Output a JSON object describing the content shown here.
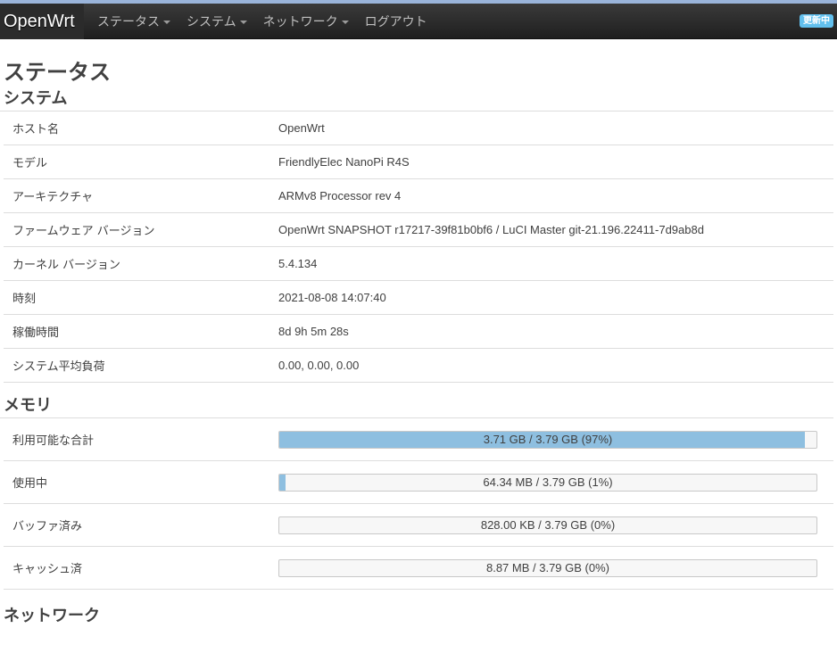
{
  "navbar": {
    "brand": "OpenWrt",
    "menu": [
      {
        "label": "ステータス",
        "dropdown": true
      },
      {
        "label": "システム",
        "dropdown": true
      },
      {
        "label": "ネットワーク",
        "dropdown": true
      },
      {
        "label": "ログアウト",
        "dropdown": false
      }
    ],
    "badge": "更新中"
  },
  "page": {
    "title": "ステータス"
  },
  "system": {
    "title": "システム",
    "rows": [
      {
        "label": "ホスト名",
        "value": "OpenWrt"
      },
      {
        "label": "モデル",
        "value": "FriendlyElec NanoPi R4S"
      },
      {
        "label": "アーキテクチャ",
        "value": "ARMv8 Processor rev 4"
      },
      {
        "label": "ファームウェア バージョン",
        "value": "OpenWrt SNAPSHOT r17217-39f81b0bf6 / LuCI Master git-21.196.22411-7d9ab8d"
      },
      {
        "label": "カーネル バージョン",
        "value": "5.4.134"
      },
      {
        "label": "時刻",
        "value": "2021-08-08 14:07:40"
      },
      {
        "label": "稼働時間",
        "value": "8d 9h 5m 28s"
      },
      {
        "label": "システム平均負荷",
        "value": "0.00, 0.00, 0.00"
      }
    ]
  },
  "memory": {
    "title": "メモリ",
    "rows": [
      {
        "label": "利用可能な合計",
        "text": "3.71 GB / 3.79 GB (97%)",
        "percent": 97.9
      },
      {
        "label": "使用中",
        "text": "64.34 MB / 3.79 GB (1%)",
        "percent": 1.1
      },
      {
        "label": "バッファ済み",
        "text": "828.00 KB / 3.79 GB (0%)",
        "percent": 0
      },
      {
        "label": "キャッシュ済",
        "text": "8.87 MB / 3.79 GB (0%)",
        "percent": 0
      }
    ]
  },
  "network": {
    "title": "ネットワーク"
  },
  "colors": {
    "progress_fill": "#8ebfe0",
    "navbar_bg": "#2b2b2b",
    "badge_bg": "#62c0ee"
  }
}
